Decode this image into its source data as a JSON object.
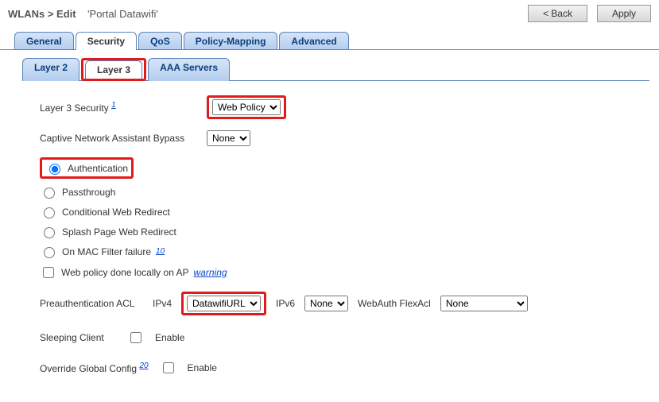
{
  "header": {
    "breadcrumb_base": "WLANs > Edit",
    "wlan_name": "'Portal Datawifi'",
    "back_label": "< Back",
    "apply_label": "Apply"
  },
  "tabs_main": [
    "General",
    "Security",
    "QoS",
    "Policy-Mapping",
    "Advanced"
  ],
  "active_main_tab": "Security",
  "tabs_sub": [
    "Layer 2",
    "Layer 3",
    "AAA Servers"
  ],
  "active_sub_tab": "Layer 3",
  "layer3": {
    "security_label": "Layer 3 Security",
    "security_footnote": "1",
    "security_select": "Web Policy",
    "captive_label": "Captive Network Assistant Bypass",
    "captive_select": "None",
    "radios": {
      "authentication": "Authentication",
      "passthrough": "Passthrough",
      "cond_redirect": "Conditional Web Redirect",
      "splash_redirect": "Splash Page Web Redirect",
      "mac_failure": "On MAC Filter failure",
      "mac_failure_foot": "10"
    },
    "web_policy_local_label": "Web policy done locally on AP",
    "web_policy_local_warn": "warning",
    "preauth_label": "Preauthentication ACL",
    "ipv4_label": "IPv4",
    "ipv4_select": "DatawifiURL",
    "ipv6_label": "IPv6",
    "ipv6_select": "None",
    "webauth_flex_label": "WebAuth FlexAcl",
    "webauth_flex_select": "None",
    "sleeping_client_label": "Sleeping Client",
    "enable_label": "Enable",
    "override_global_label": "Override Global Config",
    "override_global_foot": "20"
  }
}
